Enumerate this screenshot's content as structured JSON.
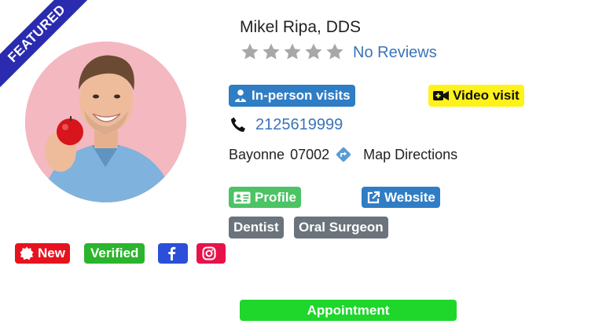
{
  "ribbon": {
    "label": "FEATURED"
  },
  "doctor": {
    "name": "Mikel Ripa, DDS",
    "rating_stars": 0,
    "reviews_label": "No Reviews",
    "phone": "2125619999",
    "city": "Bayonne",
    "zip": "07002",
    "directions_label": "Map Directions"
  },
  "visit_types": {
    "in_person": "In-person visits",
    "video": "Video visit"
  },
  "links": {
    "profile": "Profile",
    "website": "Website"
  },
  "specialties": [
    "Dentist",
    "Oral Surgeon"
  ],
  "badges": {
    "new": "New",
    "verified": "Verified"
  },
  "social": [
    "facebook-icon",
    "instagram-icon"
  ],
  "appointment_label": "Appointment",
  "colors": {
    "ribbon": "#2b2bb0",
    "blue": "#2f7dc5",
    "link_text": "#3a74b8",
    "video": "#fff21a",
    "profile": "#4cc364",
    "tag": "#6b737c",
    "new": "#e8121f",
    "verified": "#2ab52c",
    "facebook": "#2a4fd8",
    "instagram": "#e8124a",
    "appointment": "#1fd62b",
    "star": "#a8a8a8"
  }
}
